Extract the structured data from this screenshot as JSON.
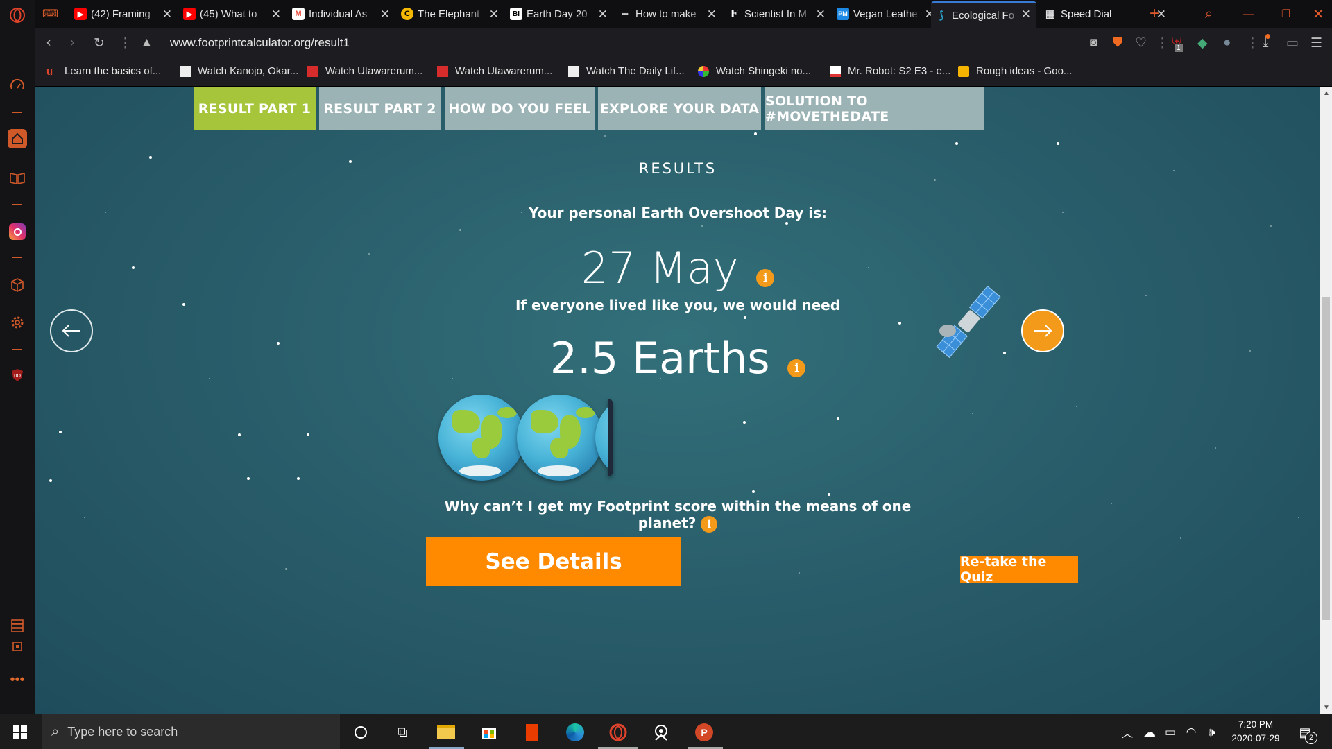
{
  "browser": {
    "tabs": [
      {
        "title": "(42) Framing",
        "fav": "youtube-icon",
        "color": "#ff0000"
      },
      {
        "title": "(45) What to",
        "fav": "youtube-icon",
        "color": "#ff0000"
      },
      {
        "title": "Individual As",
        "fav": "gmail-icon",
        "color": "#ea4335"
      },
      {
        "title": "The Elephant",
        "fav": "g-icon",
        "color": "#f5b800"
      },
      {
        "title": "Earth Day 20",
        "fav": "bi-icon",
        "color": "#000000"
      },
      {
        "title": "How to make",
        "fav": "dots-icon",
        "color": "#555555"
      },
      {
        "title": "Scientist In M",
        "fav": "f-icon",
        "color": "#000000"
      },
      {
        "title": "Vegan Leathe",
        "fav": "pm-icon",
        "color": "#1e88e5"
      },
      {
        "title": "Ecological Fo",
        "fav": "footprint-icon",
        "color": "#2aa0c8"
      },
      {
        "title": "Speed Dial",
        "fav": "grid-icon",
        "color": "#cccccc"
      }
    ],
    "fav_glyphs": [
      "▶",
      "▶",
      "M",
      "C",
      "BI",
      "•••",
      "F",
      "PM",
      "⟆",
      "▦"
    ],
    "url": "www.footprintcalculator.org/result1",
    "badge_count": "1",
    "bookmarks": [
      "Learn the basics of...",
      "Watch Kanojo, Okar...",
      "Watch Utawarerum...",
      "Watch Utawarerum...",
      "Watch The Daily Lif...",
      "Watch Shingeki no...",
      "Mr. Robot: S2 E3 - e...",
      "Rough ideas - Goo..."
    ]
  },
  "page": {
    "nav_tabs": [
      "RESULT PART 1",
      "RESULT PART 2",
      "HOW DO YOU FEEL",
      "EXPLORE YOUR DATA",
      "SOLUTION TO #MOVETHEDATE"
    ],
    "heading": "RESULTS",
    "overshoot_label": "Your personal Earth Overshoot Day is:",
    "overshoot_date": "27 May",
    "earths_label": "If everyone lived like you, we would need",
    "earths_value": "2.5 Earths",
    "earths_count": 2.5,
    "info_glyph": "i",
    "why_line1": "Why can’t I get my Footprint score within the means of one",
    "why_line2": "planet?",
    "see_details": "See Details",
    "retake": "Re-take the Quiz",
    "accent_green": "#a6c53a",
    "accent_orange": "#f39a1b",
    "button_orange": "#ff8a00"
  },
  "taskbar": {
    "search_placeholder": "Type here to search",
    "time": "7:20 PM",
    "date": "2020-07-29",
    "notification_count": "2"
  }
}
